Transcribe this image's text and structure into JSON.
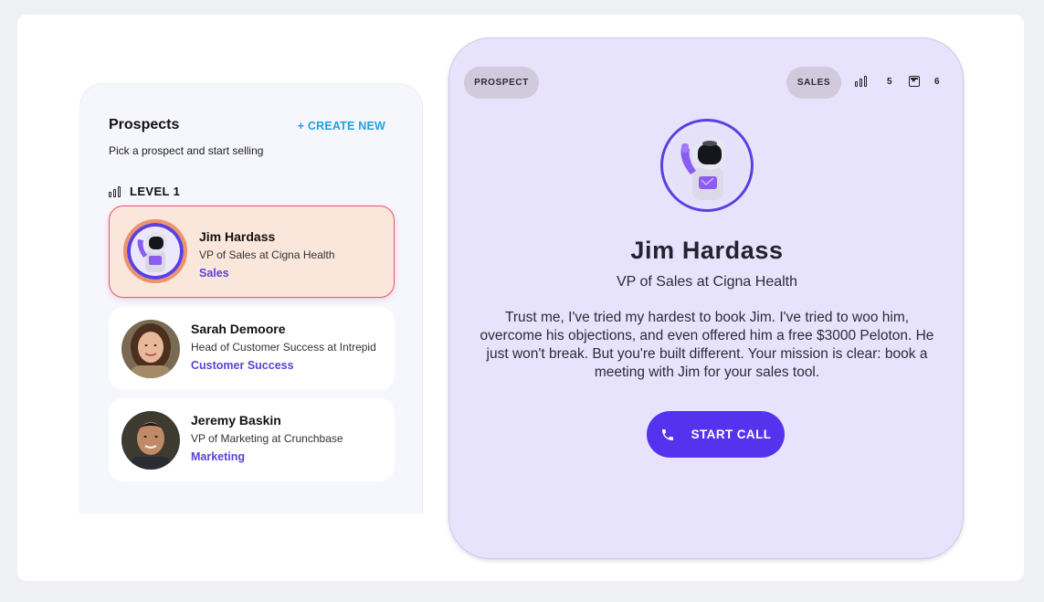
{
  "prospects": {
    "title": "Prospects",
    "create_label": "+ CREATE NEW",
    "subtitle": "Pick a prospect and start selling",
    "level_label": "LEVEL 1",
    "items": [
      {
        "name": "Jim Hardass",
        "role": "VP of Sales at Cigna Health",
        "department": "Sales",
        "avatar": "astronaut-avatar",
        "selected": true
      },
      {
        "name": "Sarah Demoore",
        "role": "Head of Customer Success at Intrepid",
        "department": "Customer Success",
        "avatar": "woman-photo-avatar",
        "selected": false
      },
      {
        "name": "Jeremy Baskin",
        "role": "VP of Marketing at Crunchbase",
        "department": "Marketing",
        "avatar": "man-photo-avatar",
        "selected": false
      }
    ]
  },
  "detail": {
    "tag_left": "PROSPECT",
    "tag_right": "SALES",
    "level_count": "5",
    "calls_count": "6",
    "name": "Jim Hardass",
    "role": "VP of Sales at Cigna Health",
    "description": "Trust me, I've tried my hardest to book Jim. I've tried to woo him, overcome his objections, and even offered him a free $3000 Peloton. He just won't break. But you're built different. Your mission is clear: book a meeting with Jim for your sales tool.",
    "cta_label": "START CALL"
  },
  "colors": {
    "accent": "#5533ee",
    "link": "#1ea2e0",
    "department": "#5a43d6",
    "selected_card_bg": "#fbe6dc",
    "selected_card_border": "#e25873",
    "detail_bg": "#e8e3fc"
  }
}
